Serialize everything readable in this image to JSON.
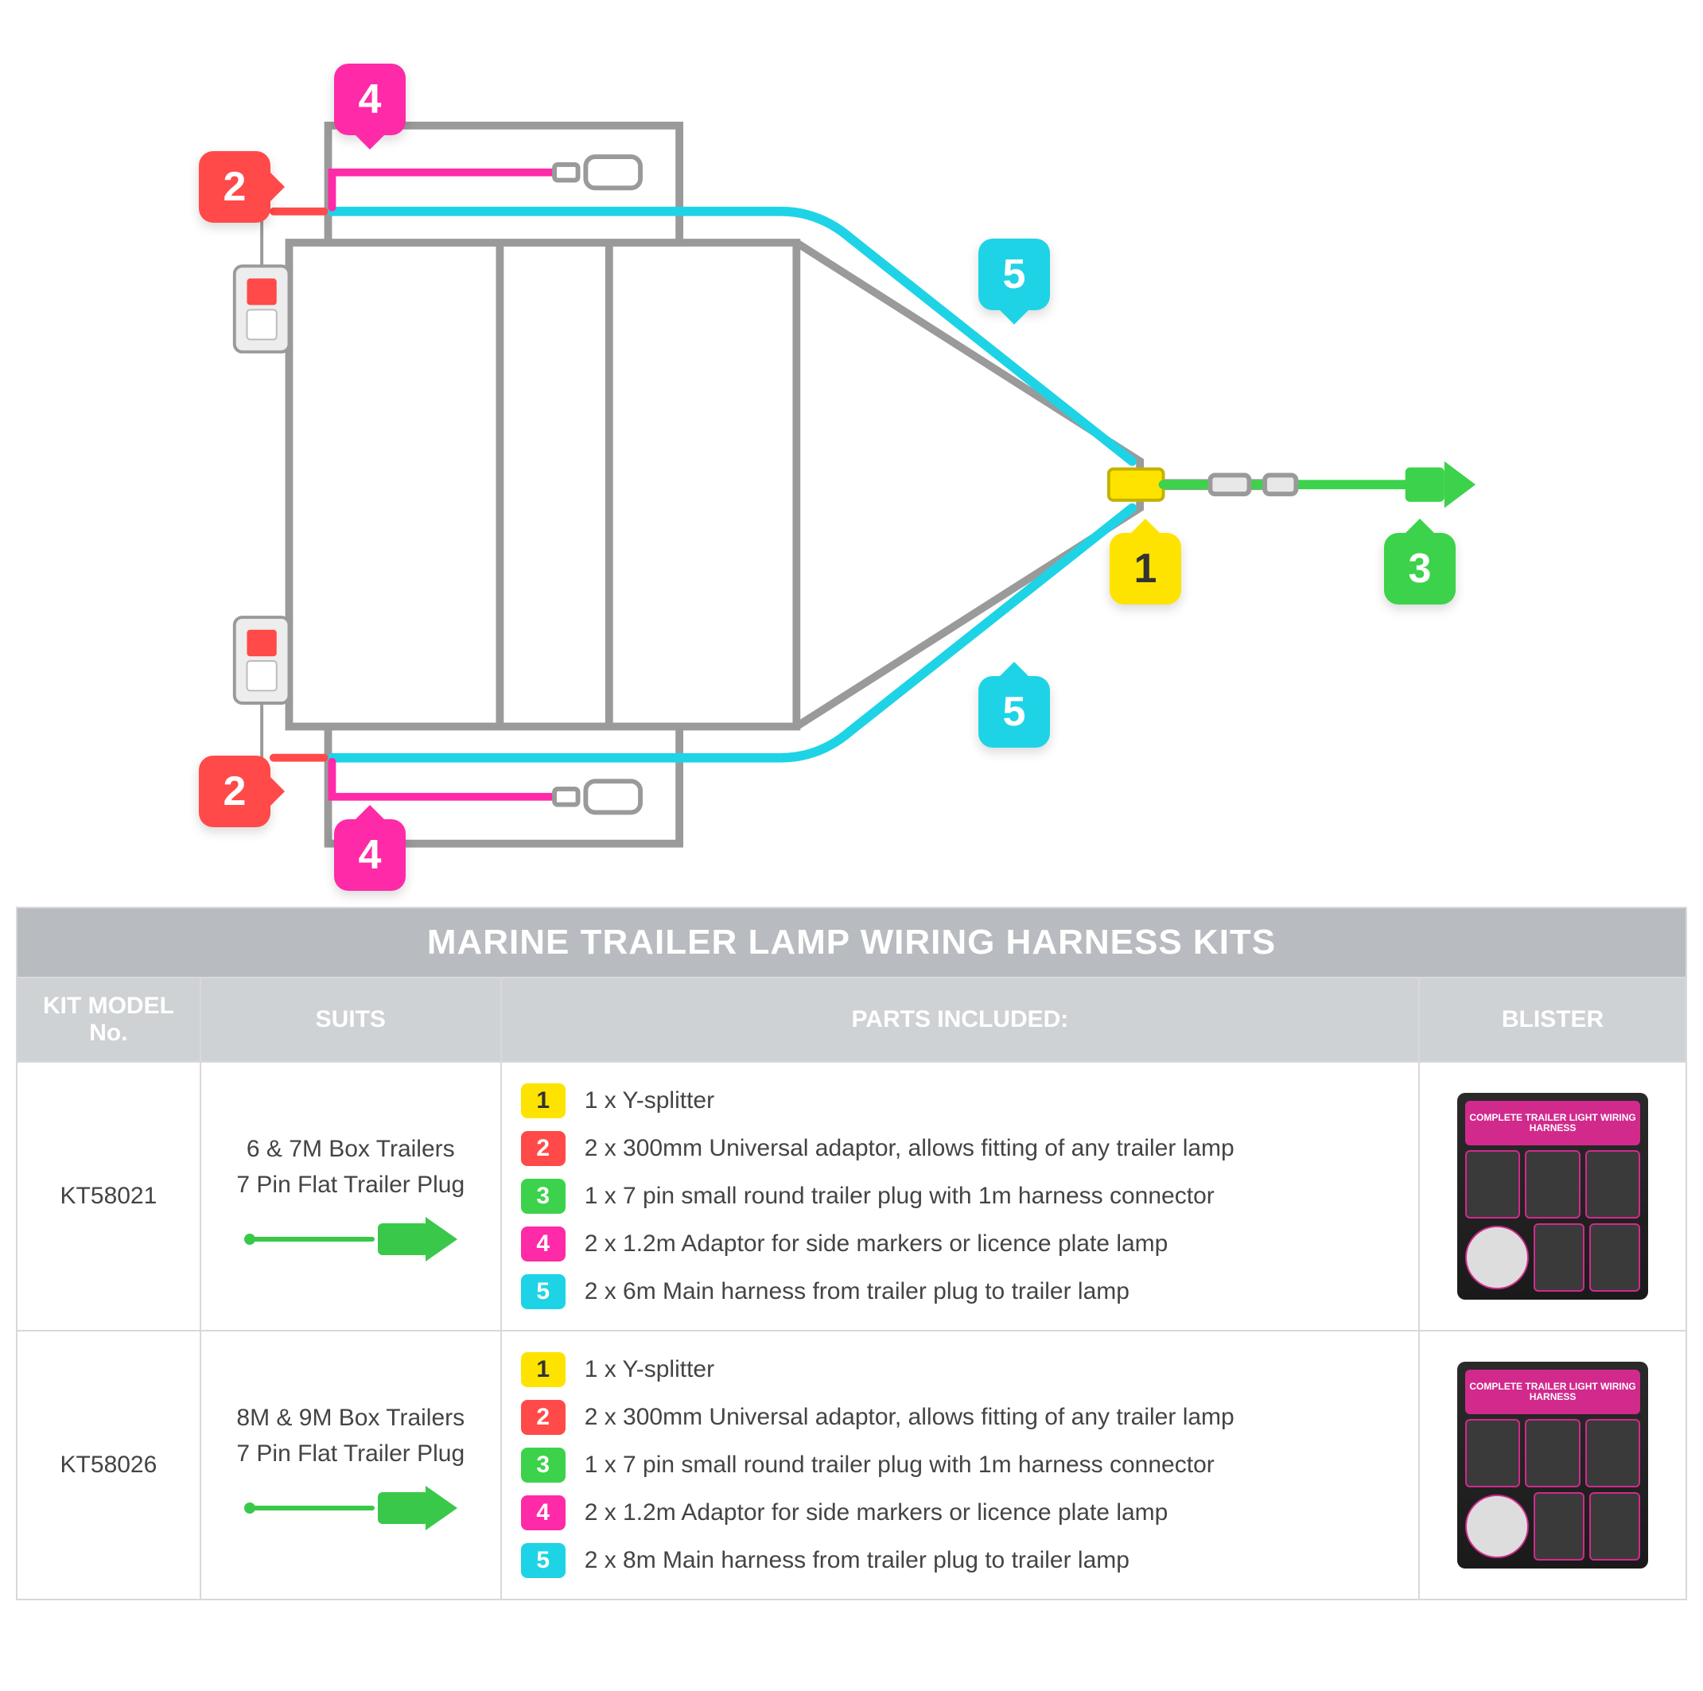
{
  "diagram": {
    "callouts": {
      "1": "1",
      "2": "2",
      "3": "3",
      "4": "4",
      "5": "5"
    }
  },
  "table": {
    "title": "MARINE TRAILER LAMP WIRING HARNESS KITS",
    "headers": {
      "model": "KIT MODEL No.",
      "suits": "SUITS",
      "parts": "PARTS INCLUDED:",
      "blister": "BLISTER"
    },
    "blister_label": "COMPLETE TRAILER LIGHT WIRING HARNESS",
    "rows": [
      {
        "model": "KT58021",
        "suits_line1": "6 & 7M Box Trailers",
        "suits_line2": "7 Pin Flat Trailer Plug",
        "parts": [
          {
            "n": "1",
            "text": "1 x Y-splitter"
          },
          {
            "n": "2",
            "text": "2 x 300mm Universal adaptor, allows fitting of any trailer lamp"
          },
          {
            "n": "3",
            "text": "1 x 7 pin small round trailer plug with 1m harness connector"
          },
          {
            "n": "4",
            "text": "2 x 1.2m Adaptor for side markers or licence plate lamp"
          },
          {
            "n": "5",
            "text": "2 x 6m Main harness from trailer plug to trailer lamp"
          }
        ]
      },
      {
        "model": "KT58026",
        "suits_line1": "8M & 9M Box Trailers",
        "suits_line2": "7 Pin Flat Trailer Plug",
        "parts": [
          {
            "n": "1",
            "text": "1 x Y-splitter"
          },
          {
            "n": "2",
            "text": "2 x 300mm Universal adaptor, allows fitting of any trailer lamp"
          },
          {
            "n": "3",
            "text": "1 x 7 pin small round trailer plug with 1m harness connector"
          },
          {
            "n": "4",
            "text": "2 x 1.2m Adaptor for side markers or licence plate lamp"
          },
          {
            "n": "5",
            "text": "2 x 8m Main harness from trailer plug to trailer lamp"
          }
        ]
      }
    ]
  }
}
